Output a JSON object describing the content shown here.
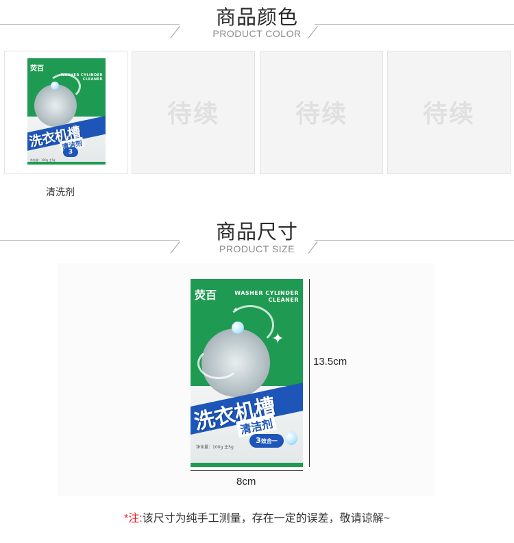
{
  "color_section": {
    "title": "商品颜色",
    "subtitle": "PRODUCT COLOR",
    "cards": [
      {
        "type": "product",
        "label": "清洗剂"
      },
      {
        "type": "placeholder",
        "text": "待续"
      },
      {
        "type": "placeholder",
        "text": "待续"
      },
      {
        "type": "placeholder",
        "text": "待续"
      }
    ]
  },
  "size_section": {
    "title": "商品尺寸",
    "subtitle": "PRODUCT SIZE",
    "height_label": "13.5cm",
    "width_label": "8cm"
  },
  "package": {
    "brand": "荧百",
    "english_line1": "WASHER CYLINDER",
    "english_line2": "CLEANER",
    "main_text": "洗衣机槽",
    "sub_text": "清洁剂",
    "badge_number": "3",
    "badge_text": "效合一",
    "net_weight": "净含量：100g 主5g"
  },
  "note": {
    "marker": "*注:",
    "text": "该尺寸为纯手工测量，存在一定的误差，敬请谅解~"
  },
  "colors": {
    "package_green": "#1f9a52",
    "package_blue": "#1d56b8",
    "note_red": "#e51c23"
  }
}
